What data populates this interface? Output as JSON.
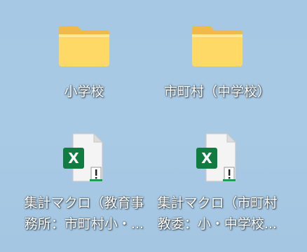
{
  "desktop": {
    "icons": [
      {
        "kind": "folder",
        "label": "小学校"
      },
      {
        "kind": "folder",
        "label": "市町村（中学校）"
      },
      {
        "kind": "excel",
        "label_line1": "集計マクロ（教育事",
        "label_line2": "務所：市町村小・..."
      },
      {
        "kind": "excel",
        "label_line1": "集計マクロ（市町村",
        "label_line2": "教委：小・中学校..."
      }
    ],
    "colors": {
      "background": "#a6c8e4",
      "folder_front": "#ffd966",
      "folder_back": "#f0b94a",
      "excel_green": "#107c41",
      "doc_paper": "#f4f4f4"
    }
  }
}
